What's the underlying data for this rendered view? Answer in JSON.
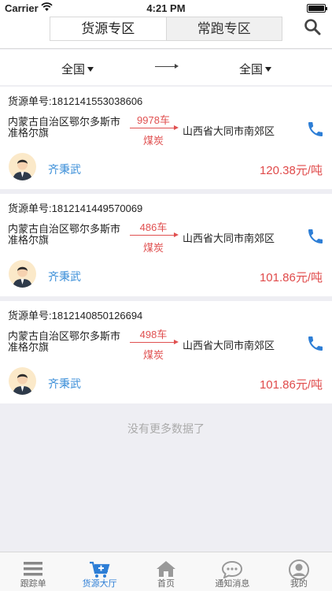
{
  "status_bar": {
    "carrier": "Carrier",
    "time": "4:21 PM"
  },
  "header": {
    "tabs": [
      {
        "label": "货源专区",
        "active": true
      },
      {
        "label": "常跑专区",
        "active": false
      }
    ],
    "search_icon": "search-icon"
  },
  "filter": {
    "from": "全国",
    "to": "全国"
  },
  "orders": [
    {
      "order_no": "货源单号:1812141553038606",
      "origin": "内蒙古自治区鄂尔多斯市准格尔旗",
      "count": "9978车",
      "cargo": "煤炭",
      "destination": "山西省大同市南郊区",
      "contact": "齐秉武",
      "price": "120.38元/吨"
    },
    {
      "order_no": "货源单号:1812141449570069",
      "origin": "内蒙古自治区鄂尔多斯市准格尔旗",
      "count": "486车",
      "cargo": "煤炭",
      "destination": "山西省大同市南郊区",
      "contact": "齐秉武",
      "price": "101.86元/吨"
    },
    {
      "order_no": "货源单号:1812140850126694",
      "origin": "内蒙古自治区鄂尔多斯市准格尔旗",
      "count": "498车",
      "cargo": "煤炭",
      "destination": "山西省大同市南郊区",
      "contact": "齐秉武",
      "price": "101.86元/吨"
    }
  ],
  "no_more_text": "没有更多数据了",
  "tabbar": [
    {
      "label": "跟踪单",
      "icon": "menu-icon",
      "active": false
    },
    {
      "label": "货源大厅",
      "icon": "cart-icon",
      "active": true
    },
    {
      "label": "首页",
      "icon": "home-icon",
      "active": false
    },
    {
      "label": "通知消息",
      "icon": "chat-icon",
      "active": false
    },
    {
      "label": "我的",
      "icon": "user-icon",
      "active": false
    }
  ],
  "colors": {
    "accent": "#2d7ed6",
    "price": "#e04a4a",
    "route": "#e05050",
    "contact": "#3a8ed8"
  }
}
